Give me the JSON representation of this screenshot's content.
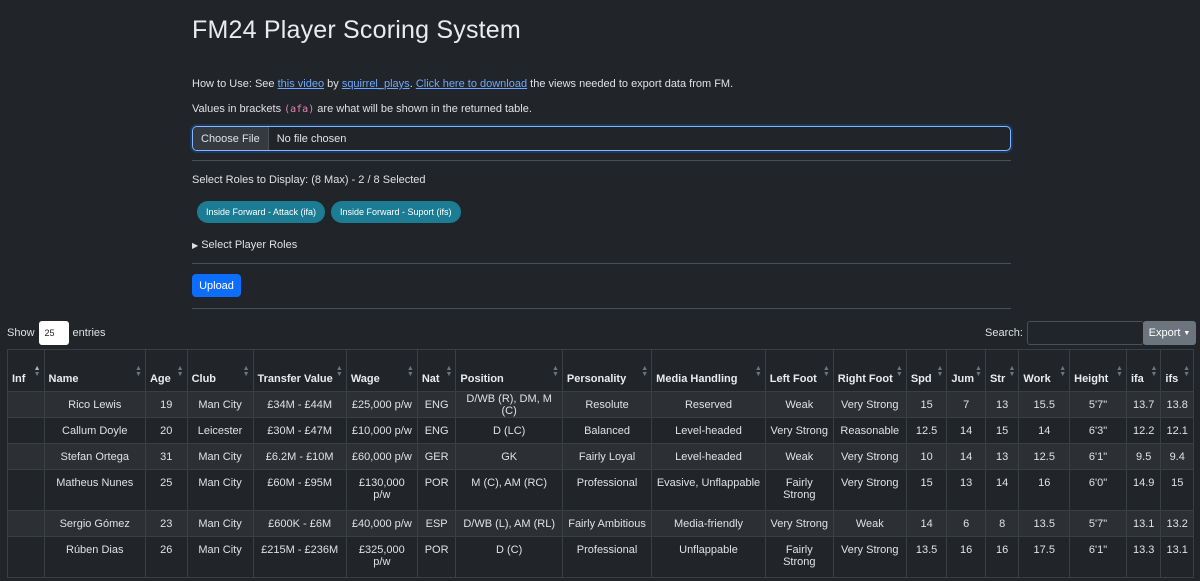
{
  "title": "FM24 Player Scoring System",
  "howto": {
    "prefix": "How to Use: See ",
    "video_link": "this video",
    "by": " by ",
    "author_link": "squirrel_plays",
    "sep": ". ",
    "download_link": "Click here to download",
    "suffix": " the views needed to export data from FM."
  },
  "values_note": {
    "prefix": "Values in brackets ",
    "code": "(afa)",
    "suffix": " are what will be shown in the returned table."
  },
  "file_input": {
    "button": "Choose File",
    "status": "No file chosen"
  },
  "roles_label": "Select Roles to Display: (8 Max) - 2 / 8 Selected",
  "selected_roles": [
    "Inside Forward - Attack (ifa)",
    "Inside Forward - Suport (ifs)"
  ],
  "select_player_roles": "Select Player Roles",
  "upload_label": "Upload",
  "show": {
    "prefix": "Show",
    "value": "25",
    "suffix": "entries"
  },
  "search_label": "Search:",
  "export_label": "Export",
  "table": {
    "headers": [
      "Inf",
      "Name",
      "Age",
      "Club",
      "Transfer Value",
      "Wage",
      "Nat",
      "Position",
      "Personality",
      "Media Handling",
      "Left Foot",
      "Right Foot",
      "Spd",
      "Jum",
      "Str",
      "Work",
      "Height",
      "ifa",
      "ifs"
    ],
    "rows": [
      [
        "",
        "Rico Lewis",
        "19",
        "Man City",
        "£34M - £44M",
        "£25,000 p/w",
        "ENG",
        "D/WB (R), DM, M (C)",
        "Resolute",
        "Reserved",
        "Weak",
        "Very Strong",
        "15",
        "7",
        "13",
        "15.5",
        "5'7\"",
        "13.7",
        "13.8"
      ],
      [
        "",
        "Callum Doyle",
        "20",
        "Leicester",
        "£30M - £47M",
        "£10,000 p/w",
        "ENG",
        "D (LC)",
        "Balanced",
        "Level-headed",
        "Very Strong",
        "Reasonable",
        "12.5",
        "14",
        "15",
        "14",
        "6'3\"",
        "12.2",
        "12.1"
      ],
      [
        "",
        "Stefan Ortega",
        "31",
        "Man City",
        "£6.2M - £10M",
        "£60,000 p/w",
        "GER",
        "GK",
        "Fairly Loyal",
        "Level-headed",
        "Weak",
        "Very Strong",
        "10",
        "14",
        "13",
        "12.5",
        "6'1\"",
        "9.5",
        "9.4"
      ],
      [
        "",
        "Matheus Nunes",
        "25",
        "Man City",
        "£60M - £95M",
        "£130,000 p/w",
        "POR",
        "M (C), AM (RC)",
        "Professional",
        "Evasive, Unflappable",
        "Fairly Strong",
        "Very Strong",
        "15",
        "13",
        "14",
        "16",
        "6'0\"",
        "14.9",
        "15"
      ],
      [
        "",
        "Sergio Gómez",
        "23",
        "Man City",
        "£600K - £6M",
        "£40,000 p/w",
        "ESP",
        "D/WB (L), AM (RL)",
        "Fairly Ambitious",
        "Media-friendly",
        "Very Strong",
        "Weak",
        "14",
        "6",
        "8",
        "13.5",
        "5'7\"",
        "13.1",
        "13.2"
      ],
      [
        "",
        "Rúben Dias",
        "26",
        "Man City",
        "£215M - £236M",
        "£325,000 p/w",
        "POR",
        "D (C)",
        "Professional",
        "Unflappable",
        "Fairly Strong",
        "Very Strong",
        "13.5",
        "16",
        "16",
        "17.5",
        "6'1\"",
        "13.3",
        "13.1"
      ]
    ]
  }
}
